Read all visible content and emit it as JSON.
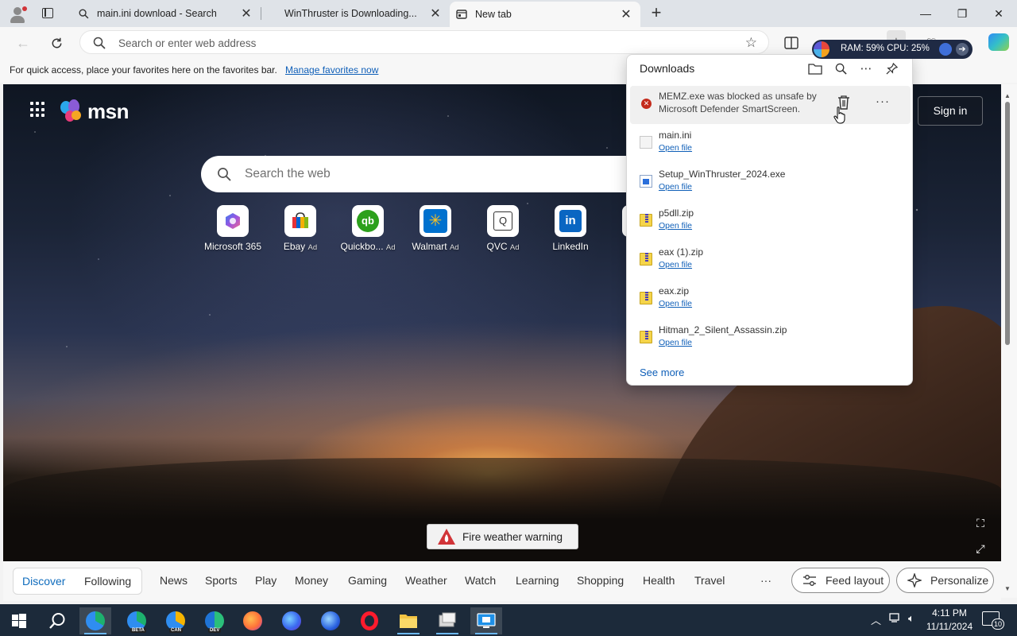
{
  "tabs": [
    {
      "title": "main.ini download - Search",
      "icon": "search-icon"
    },
    {
      "title": "WinThruster is Downloading...",
      "icon": "none"
    },
    {
      "title": "New tab",
      "icon": "new-tab-page-icon",
      "active": true
    }
  ],
  "address_bar": {
    "placeholder": "Search or enter web address"
  },
  "resource_monitor": {
    "text": "RAM: 59%  CPU: 25%"
  },
  "favorites_bar": {
    "message": "For quick access, place your favorites here on the favorites bar.",
    "link": "Manage favorites now"
  },
  "msn": {
    "logo": "msn",
    "search_placeholder": "Search the web",
    "sign_in": "Sign in",
    "tiles": [
      {
        "label": "Microsoft 365",
        "ad": ""
      },
      {
        "label": "Ebay",
        "ad": "Ad"
      },
      {
        "label": "Quickbo...",
        "ad": "Ad"
      },
      {
        "label": "Walmart",
        "ad": "Ad"
      },
      {
        "label": "QVC",
        "ad": "Ad"
      },
      {
        "label": "LinkedIn",
        "ad": ""
      }
    ],
    "alert": "Fire weather warning"
  },
  "categories": {
    "pills": [
      "Discover",
      "Following"
    ],
    "active": "Discover",
    "items": [
      "News",
      "Sports",
      "Play",
      "Money",
      "Gaming",
      "Weather",
      "Watch",
      "Learning",
      "Shopping",
      "Health",
      "Travel"
    ],
    "more": "···",
    "feed_layout": "Feed layout",
    "personalize": "Personalize"
  },
  "downloads": {
    "title": "Downloads",
    "blocked_item": {
      "text": "MEMZ.exe was blocked as unsafe by Microsoft Defender SmartScreen.",
      "status": "error"
    },
    "items": [
      {
        "name": "main.ini",
        "action": "Open file",
        "icon": "ini-file-icon"
      },
      {
        "name": "Setup_WinThruster_2024.exe",
        "action": "Open file",
        "icon": "exe-file-icon"
      },
      {
        "name": "p5dll.zip",
        "action": "Open file",
        "icon": "zip-file-icon"
      },
      {
        "name": "eax (1).zip",
        "action": "Open file",
        "icon": "zip-file-icon"
      },
      {
        "name": "eax.zip",
        "action": "Open file",
        "icon": "zip-file-icon"
      },
      {
        "name": "Hitman_2_Silent_Assassin.zip",
        "action": "Open file",
        "icon": "zip-file-icon"
      }
    ],
    "see_more": "See more"
  },
  "taskbar": {
    "apps": [
      "start",
      "search",
      "edge",
      "edge-beta",
      "edge-canary",
      "edge-dev",
      "firefox",
      "firefox-developer",
      "firefox-nightly",
      "opera",
      "file-explorer",
      "unknown-app",
      "remote-desktop"
    ],
    "badges": {
      "beta": "BETA",
      "canary": "CAN",
      "dev": "DEV"
    },
    "time": "4:11 PM",
    "date": "11/11/2024",
    "notifications": "10"
  },
  "colors": {
    "accent": "#0f6cbd",
    "link": "#0f5fb8",
    "error": "#c42b1c",
    "taskbar": "#1c2a3a"
  }
}
